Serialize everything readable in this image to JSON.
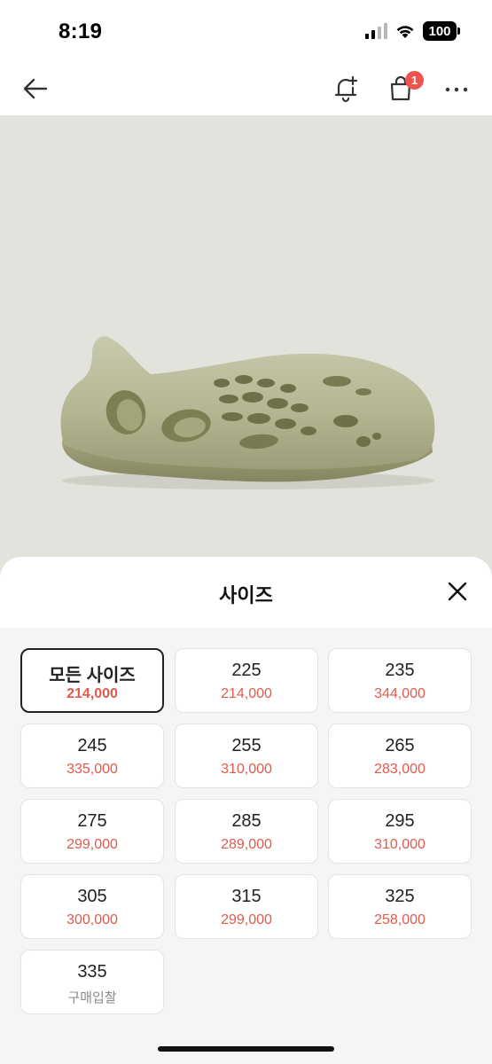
{
  "status_bar": {
    "time": "8:19",
    "battery": "100",
    "icons": [
      "signal-icon",
      "wifi-icon",
      "battery-icon"
    ]
  },
  "nav": {
    "back_icon": "arrow-left-icon",
    "bell_icon": "bell-plus-icon",
    "cart_icon": "shopping-bag-icon",
    "cart_badge": "1",
    "more_icon": "more-horizontal-icon"
  },
  "colors": {
    "accent_red": "#e05a4e",
    "badge_red": "#ef5350",
    "image_background": "#e3e3de",
    "sheet_background": "#f5f5f5"
  },
  "size_sheet": {
    "title": "사이즈",
    "close_icon": "close-icon",
    "selected_index": 0,
    "options": [
      {
        "size": "모든 사이즈",
        "price": "214,000"
      },
      {
        "size": "225",
        "price": "214,000"
      },
      {
        "size": "235",
        "price": "344,000"
      },
      {
        "size": "245",
        "price": "335,000"
      },
      {
        "size": "255",
        "price": "310,000"
      },
      {
        "size": "265",
        "price": "283,000"
      },
      {
        "size": "275",
        "price": "299,000"
      },
      {
        "size": "285",
        "price": "289,000"
      },
      {
        "size": "295",
        "price": "310,000"
      },
      {
        "size": "305",
        "price": "300,000"
      },
      {
        "size": "315",
        "price": "299,000"
      },
      {
        "size": "325",
        "price": "258,000"
      },
      {
        "size": "335",
        "price": "구매입찰"
      }
    ]
  }
}
